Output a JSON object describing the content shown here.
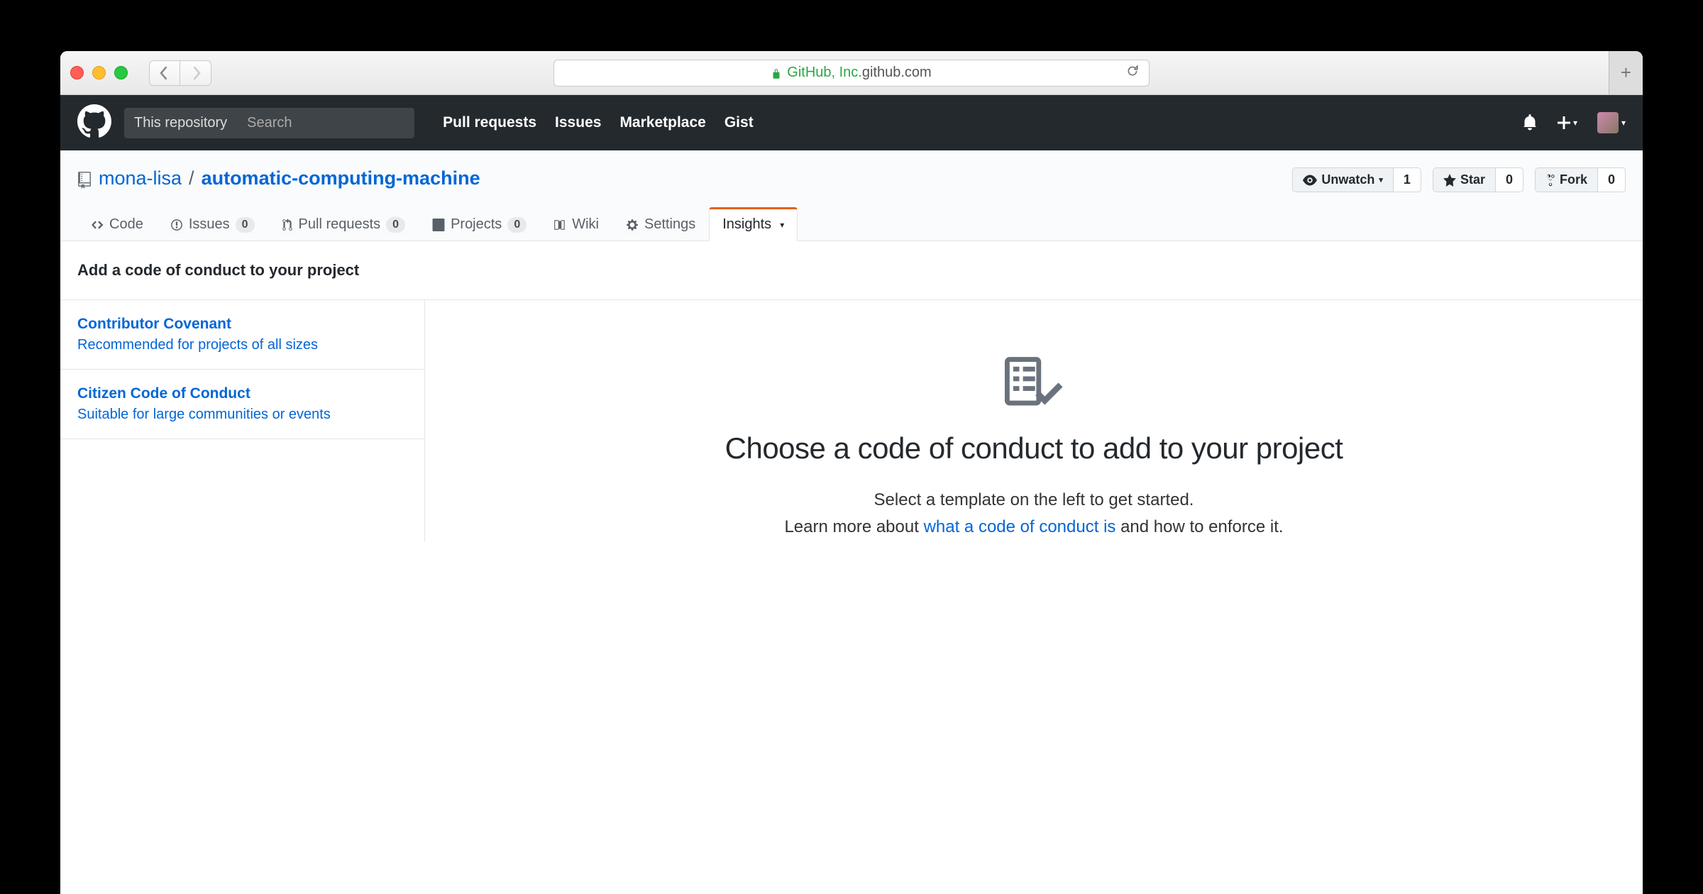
{
  "browser": {
    "org_label": "GitHub, Inc.",
    "domain": " github.com"
  },
  "gh_header": {
    "scope_label": "This repository",
    "search_placeholder": "Search",
    "nav": [
      "Pull requests",
      "Issues",
      "Marketplace",
      "Gist"
    ]
  },
  "repohead": {
    "owner": "mona-lisa",
    "name": "automatic-computing-machine",
    "actions": [
      {
        "label": "Unwatch",
        "count": "1"
      },
      {
        "label": "Star",
        "count": "0"
      },
      {
        "label": "Fork",
        "count": "0"
      }
    ]
  },
  "reponav": {
    "items": [
      {
        "label": "Code",
        "count": null
      },
      {
        "label": "Issues",
        "count": "0"
      },
      {
        "label": "Pull requests",
        "count": "0"
      },
      {
        "label": "Projects",
        "count": "0"
      },
      {
        "label": "Wiki",
        "count": null
      },
      {
        "label": "Settings",
        "count": null
      },
      {
        "label": "Insights",
        "count": null,
        "selected": true,
        "caret": true
      }
    ]
  },
  "page": {
    "title": "Add a code of conduct to your project",
    "templates": [
      {
        "title": "Contributor Covenant",
        "desc": "Recommended for projects of all sizes"
      },
      {
        "title": "Citizen Code of Conduct",
        "desc": "Suitable for large communities or events"
      }
    ],
    "blank": {
      "heading": "Choose a code of conduct to add to your project",
      "line1": "Select a template on the left to get started.",
      "line2_before": "Learn more about ",
      "line2_link": "what a code of conduct is",
      "line2_after": " and how to enforce it."
    }
  }
}
